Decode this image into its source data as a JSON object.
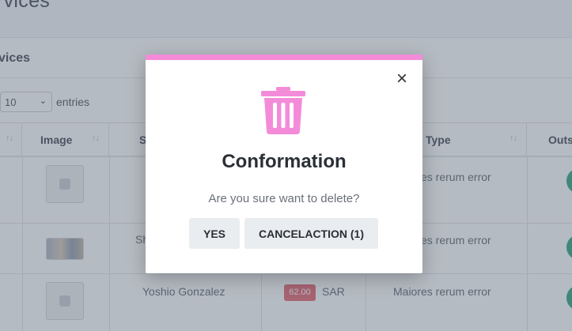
{
  "page": {
    "title": "rvices"
  },
  "card": {
    "title": "vices"
  },
  "length_menu": {
    "selected": "10",
    "suffix": "entries"
  },
  "table": {
    "headers": [
      {
        "label": ""
      },
      {
        "label": "Image"
      },
      {
        "label": "S"
      },
      {
        "label": ""
      },
      {
        "label": "Type"
      },
      {
        "label": "Outs"
      }
    ],
    "rows": [
      {
        "image": "placeholder",
        "name": "",
        "price": "",
        "currency": "",
        "type": "Maiores rerum error"
      },
      {
        "image": "photo",
        "name": "Sh",
        "price": "",
        "currency": "",
        "type": "Maiores rerum error"
      },
      {
        "image": "placeholder",
        "name": "Yoshio Gonzalez",
        "price": "62.00",
        "currency": "SAR",
        "type": "Maiores rerum error"
      }
    ]
  },
  "modal": {
    "icon": "trash-icon",
    "title": "Conformation",
    "message": "Are you sure want to delete?",
    "yes_label": "YES",
    "cancel_label": "CANCELACTION (1)",
    "close_icon": "close-icon"
  },
  "colors": {
    "accent_pink": "#f48bd9",
    "badge_red": "#e4606d",
    "toggle_green": "#28a07b"
  }
}
